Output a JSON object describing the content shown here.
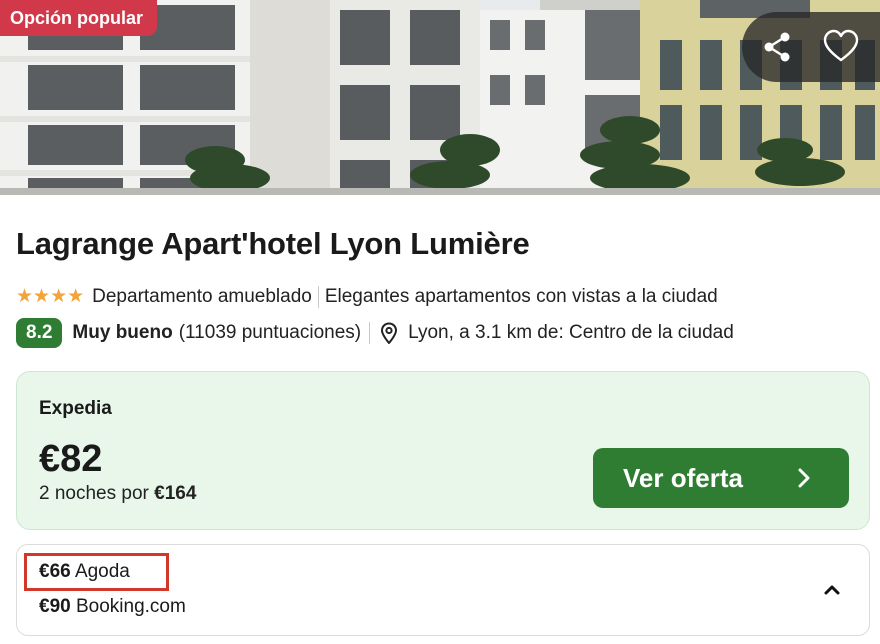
{
  "badge": {
    "label": "Opción popular"
  },
  "actions": {
    "share_icon": "share-icon",
    "favorite_icon": "heart-icon"
  },
  "hotel": {
    "name": "Lagrange Apart'hotel Lyon Lumière",
    "stars": "★★★★",
    "star_count": 4,
    "type": "Departamento amueblado",
    "tagline": "Elegantes apartamentos con vistas a la ciudad",
    "score": "8.2",
    "rating_word": "Muy bueno",
    "reviews": "(11039 puntuaciones)",
    "location": "Lyon, a 3.1 km de: Centro de la ciudad"
  },
  "offer": {
    "provider": "Expedia",
    "price": "€82",
    "nights_prefix": "2 noches por",
    "total": "€164",
    "cta_label": "Ver oferta"
  },
  "other_prices": [
    {
      "price": "€66",
      "provider": "Agoda"
    },
    {
      "price": "€90",
      "provider": "Booking.com"
    }
  ],
  "colors": {
    "badge": "#d1394a",
    "score": "#2e7d32",
    "cta": "#2f7d32",
    "offer_bg": "#e8f7ea",
    "stars": "#f2a33a",
    "highlight": "#d2382a"
  }
}
